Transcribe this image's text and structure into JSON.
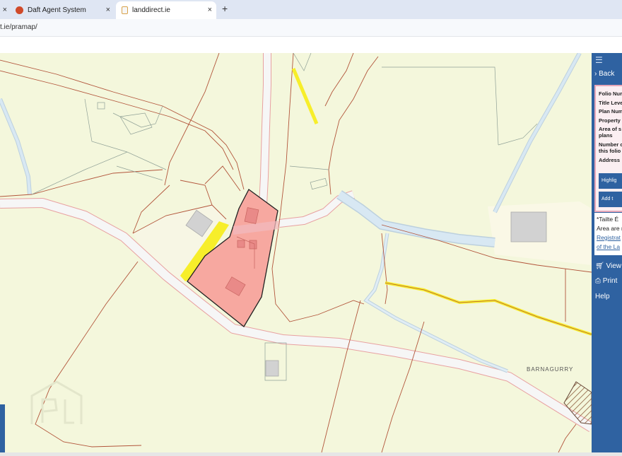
{
  "browser": {
    "tabs": [
      {
        "label": "",
        "close": "×"
      },
      {
        "label": "Daft Agent System",
        "close": "×"
      },
      {
        "label": "landdirect.ie",
        "close": "×"
      }
    ],
    "new_tab": "+",
    "url": "t.ie/pramap/"
  },
  "map": {
    "placename": "BARNAGURRY",
    "watermark": "PL"
  },
  "panel": {
    "menu": "☰",
    "back": "Back",
    "folio_lines": [
      "Folio Num",
      "Title Leve",
      "Plan Num",
      "Property",
      "Area of s",
      "plans",
      "Number o",
      "this folio",
      "Address"
    ],
    "highlight_btn": "Highlig",
    "add_btn": "Add t",
    "note_lines": [
      "*Tailte É",
      "Area are r"
    ],
    "note_links": [
      "Registrat",
      "of the La"
    ],
    "actions": {
      "view": "View",
      "print": "Print",
      "help": "Help"
    }
  },
  "colors": {
    "panel": "#2f62a1",
    "folio_highlight": "#f7a8a0",
    "road_edge": "#e8a1a1",
    "yellow_mark": "#f7ee2a"
  }
}
